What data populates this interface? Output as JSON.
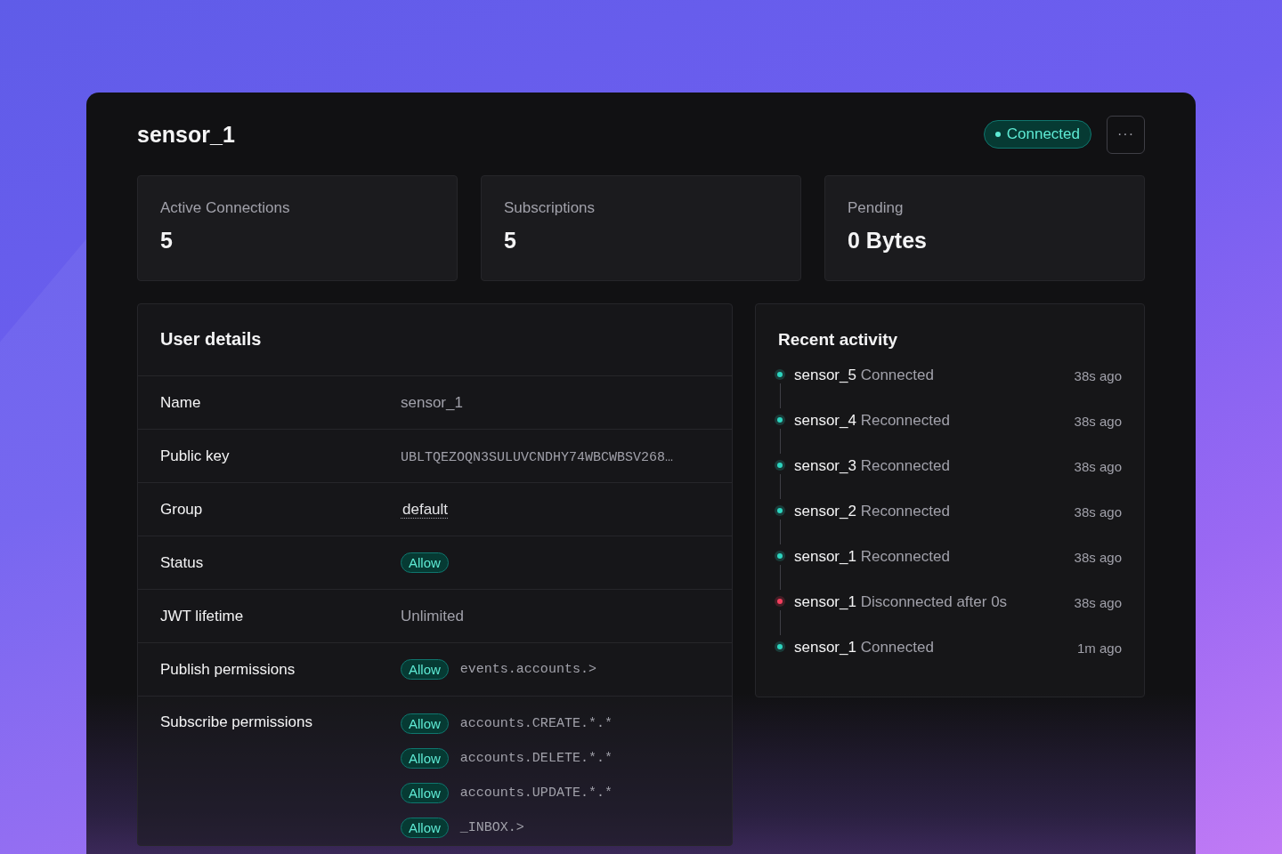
{
  "header": {
    "title": "sensor_1",
    "status": {
      "label": "Connected",
      "kind": "ok"
    },
    "menu_button": "···"
  },
  "stats": [
    {
      "label": "Active Connections",
      "value": "5"
    },
    {
      "label": "Subscriptions",
      "value": "5"
    },
    {
      "label": "Pending",
      "value": "0 Bytes"
    }
  ],
  "user_details": {
    "title": "User details",
    "rows": [
      {
        "label": "Name",
        "kind": "text",
        "value": "sensor_1"
      },
      {
        "label": "Public key",
        "kind": "mono",
        "value": "UBLTQEZOQN3SULUVCNDHY74WBCWBSV268…"
      },
      {
        "label": "Group",
        "kind": "link",
        "value": "default"
      },
      {
        "label": "Status",
        "kind": "badge",
        "value": "Allow"
      },
      {
        "label": "JWT lifetime",
        "kind": "text",
        "value": "Unlimited"
      },
      {
        "label": "Publish permissions",
        "kind": "permissions",
        "items": [
          {
            "badge": "Allow",
            "subject": "events.accounts.>"
          }
        ]
      },
      {
        "label": "Subscribe permissions",
        "kind": "permissions",
        "items": [
          {
            "badge": "Allow",
            "subject": "accounts.CREATE.*.*"
          },
          {
            "badge": "Allow",
            "subject": "accounts.DELETE.*.*"
          },
          {
            "badge": "Allow",
            "subject": "accounts.UPDATE.*.*"
          },
          {
            "badge": "Allow",
            "subject": "_INBOX.>"
          }
        ]
      }
    ]
  },
  "recent_activity": {
    "title": "Recent activity",
    "items": [
      {
        "subject": "sensor_5",
        "action": "Connected",
        "time": "38s ago",
        "color": "#2dd4bf"
      },
      {
        "subject": "sensor_4",
        "action": "Reconnected",
        "time": "38s ago",
        "color": "#2dd4bf"
      },
      {
        "subject": "sensor_3",
        "action": "Reconnected",
        "time": "38s ago",
        "color": "#2dd4bf"
      },
      {
        "subject": "sensor_2",
        "action": "Reconnected",
        "time": "38s ago",
        "color": "#2dd4bf"
      },
      {
        "subject": "sensor_1",
        "action": "Reconnected",
        "time": "38s ago",
        "color": "#2dd4bf"
      },
      {
        "subject": "sensor_1",
        "action": "Disconnected after 0s",
        "time": "38s ago",
        "color": "#f43f5e"
      },
      {
        "subject": "sensor_1",
        "action": "Connected",
        "time": "1m ago",
        "color": "#2dd4bf"
      }
    ]
  }
}
